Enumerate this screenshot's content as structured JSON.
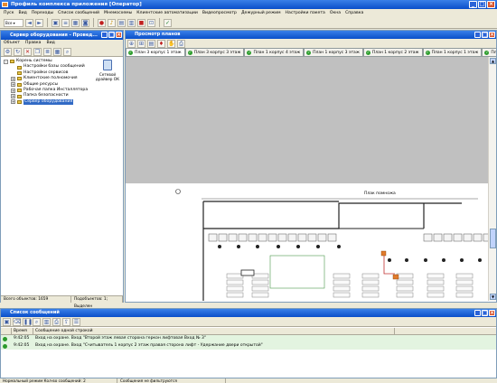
{
  "app": {
    "title": "Профиль комплекса приложения [Оператор]"
  },
  "menu": [
    "Пуск",
    "Вид",
    "Переходы",
    "Список сообщений",
    "Мнемосхемы",
    "Клиентские автоматизации",
    "Видеопросмотр",
    "Дежурный режим",
    "Настройки пакета",
    "Окна",
    "Справка"
  ],
  "toolbar": {
    "combo_value": "Все ▾"
  },
  "left_panel": {
    "title": "Сервер оборудования - Провед...",
    "menu": [
      "Объект",
      "Правка",
      "Вид"
    ],
    "tree": [
      {
        "label": "Корень системы",
        "toggle": "-",
        "depth": 0
      },
      {
        "label": "Настройки базы сообщений",
        "toggle": "",
        "depth": 1
      },
      {
        "label": "Настройки сервисов",
        "toggle": "",
        "depth": 1
      },
      {
        "label": "Клиентские полномочия",
        "toggle": "+",
        "depth": 1
      },
      {
        "label": "Общие ресурсы",
        "toggle": "+",
        "depth": 1
      },
      {
        "label": "Рабочая папка Инсталлятора",
        "toggle": "+",
        "depth": 1
      },
      {
        "label": "Папка безопасности",
        "toggle": "+",
        "depth": 1
      },
      {
        "label": "Сервер оборудования",
        "toggle": "+",
        "depth": 1,
        "selected": true
      }
    ],
    "device_label": "Сетевой драйвер ОК",
    "status": {
      "objects": "Всего объектов: 1659",
      "sub": "Подобъектов: 1; Выделен"
    }
  },
  "right_panel": {
    "title": "Просмотр планов",
    "tabs": [
      "План 3 корпус 1 этаж",
      "План 3 корпус 3 этаж",
      "План 1 корпус 4 этаж",
      "План 1 корпус 3 этаж",
      "План 1 корпус 2 этаж",
      "План 1 корпус 1 этаж",
      "План 2"
    ],
    "plan_label": "Плак помножа"
  },
  "bottom_panel": {
    "title": "Список сообщений",
    "columns": [
      "",
      "Время",
      "Сообщение одной строкой"
    ],
    "rows": [
      {
        "time": "9:42:05",
        "message": "Вход на охране. Вход \"Второй этаж левая сторона геркон лифтовая Вход № 3\""
      },
      {
        "time": "9:42:05",
        "message": "Вход на охране. Вход \"Считыватель 1 корпус 2 этаж правая сторона лифт - Удержание двери открытой\""
      }
    ]
  },
  "statusbar": {
    "mode": "Нормальный режим Кол-во сообщений: 2",
    "filter": "Сообщения не фильтруются"
  },
  "colors": {
    "title_gradient_top": "#3a80e8",
    "title_gradient_bottom": "#0a4fc9",
    "selection": "#316ac5",
    "row_ok": "#e3f4e0",
    "status_green": "#2b9a2b"
  }
}
